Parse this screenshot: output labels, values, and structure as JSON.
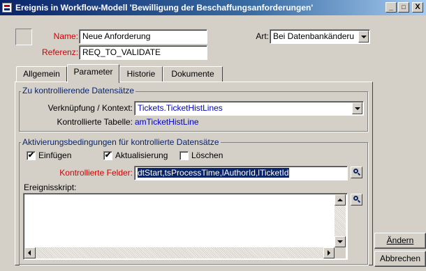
{
  "window": {
    "title": "Ereignis in Workflow-Modell 'Bewilligung der Beschaffungsanforderungen'",
    "minimize": "_",
    "maximize": "□",
    "close": "X"
  },
  "header": {
    "name_label": "Name:",
    "name_value": "Neue Anforderung",
    "referenz_label": "Referenz:",
    "referenz_value": "REQ_TO_VALIDATE",
    "art_label": "Art:",
    "art_value": "Bei Datenbankänderu"
  },
  "tabs": [
    {
      "label": "Allgemein",
      "active": false
    },
    {
      "label": "Parameter",
      "active": true
    },
    {
      "label": "Historie",
      "active": false
    },
    {
      "label": "Dokumente",
      "active": false
    }
  ],
  "group_records": {
    "title": "Zu kontrollierende Datensätze",
    "link_label": "Verknüpfung / Kontext:",
    "link_value": "Tickets.TicketHistLines",
    "table_label": "Kontrollierte Tabelle:",
    "table_value": "amTicketHistLine"
  },
  "group_activation": {
    "title": "Aktivierungsbedingungen für kontrollierte Datensätze",
    "checkboxes": [
      {
        "label": "Einfügen",
        "checked": true,
        "mark": "✔"
      },
      {
        "label": "Aktualisierung",
        "checked": true,
        "mark": "✔"
      },
      {
        "label": "Löschen",
        "checked": false,
        "mark": ""
      }
    ],
    "fields_label": "Kontrollierte Felder:",
    "fields_value": "dtStart,tsProcessTime,lAuthorId,lTicketId",
    "script_label": "Ereignisskript:",
    "script_value": ""
  },
  "buttons": {
    "modify": "Ändern",
    "cancel": "Abbrechen"
  },
  "colors": {
    "title_gradient_start": "#0a246a",
    "required_label": "#d00000",
    "link_text": "#0000c8",
    "selection": "#0a246a"
  }
}
